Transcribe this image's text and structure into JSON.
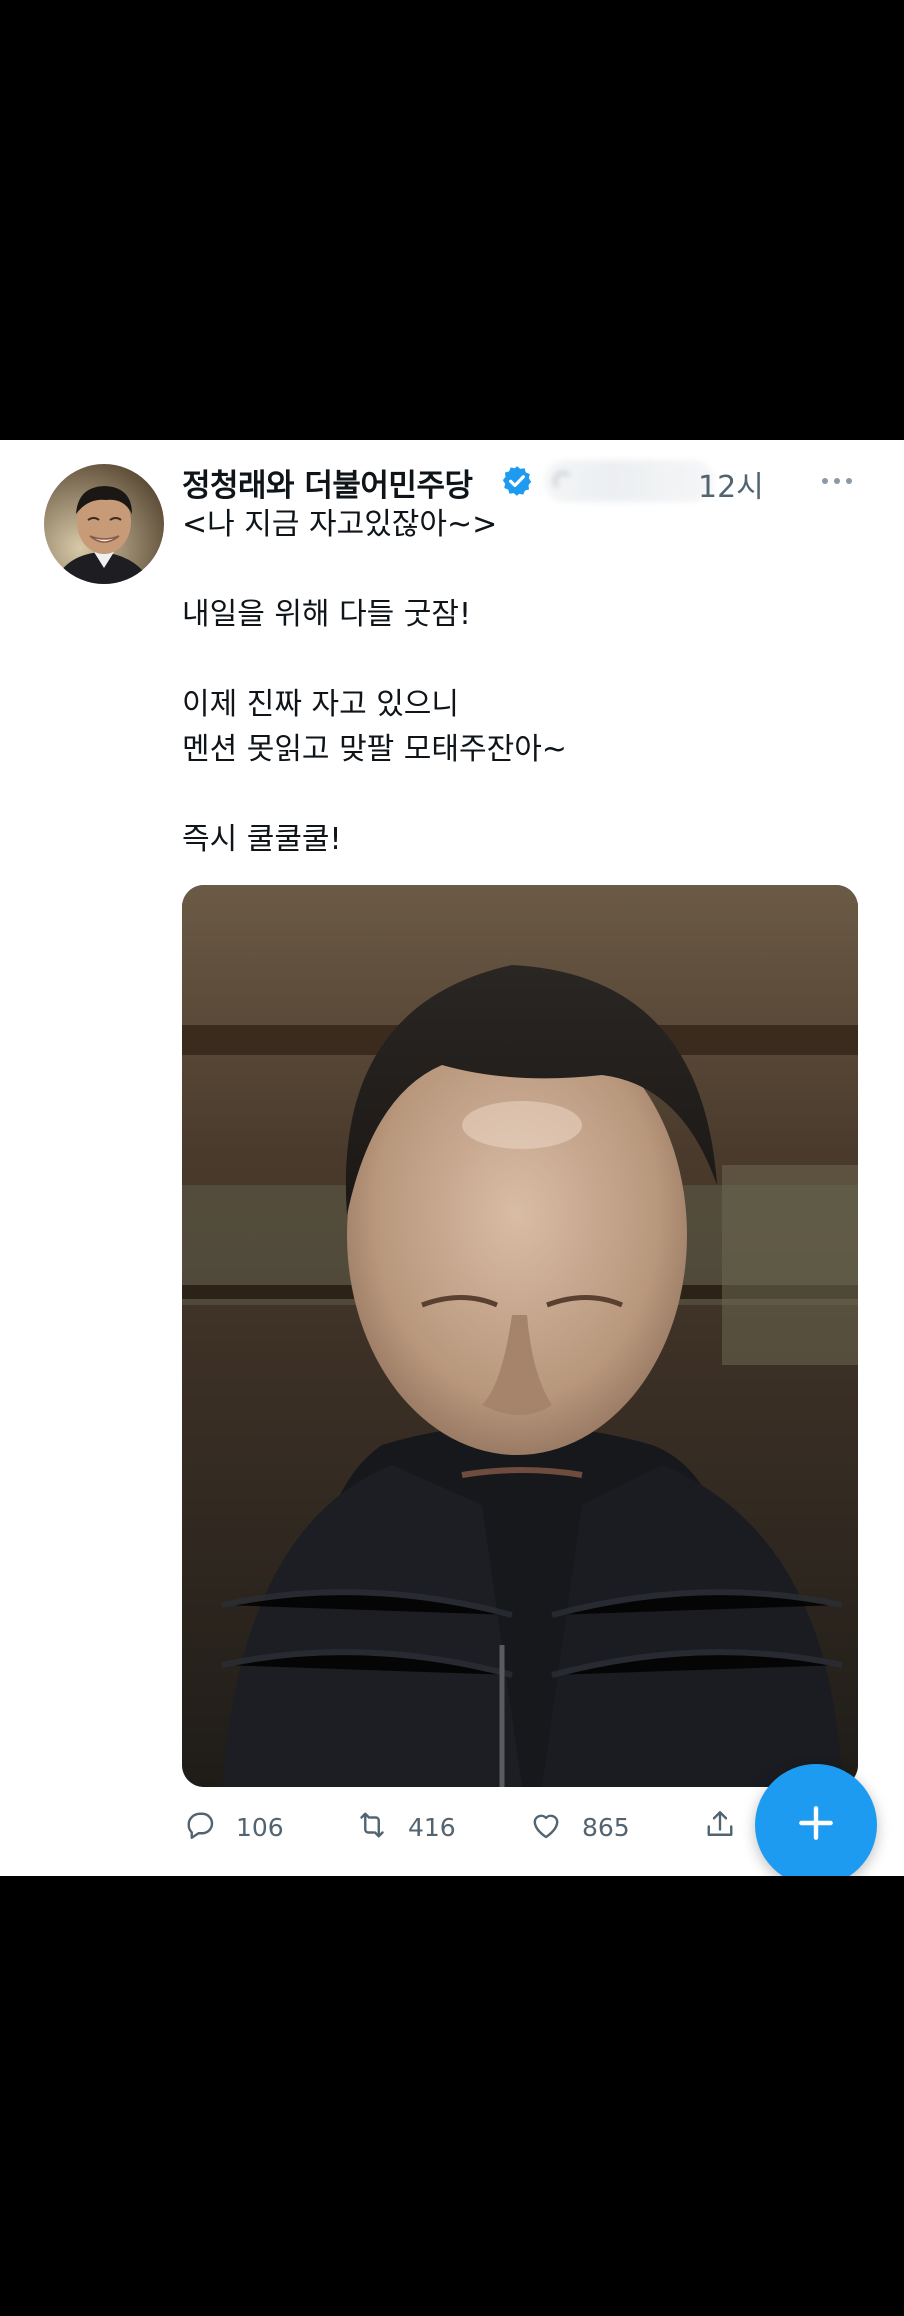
{
  "tweet": {
    "display_name": "정청래와 더불어민주당",
    "verified": true,
    "timestamp": "12시",
    "paragraphs": [
      "<나 지금 자고있잖아~>",
      "내일을 위해 다들 굿잠!",
      "이제 진짜 자고 있으니\n멘션 못읽고 맞팔 모태주잔아~",
      "즉시 쿨쿨쿨!"
    ],
    "actions": {
      "reply_count": "106",
      "retweet_count": "416",
      "like_count": "865"
    }
  },
  "icons": {
    "verified": "verified-badge-icon",
    "more": "more-dots-icon",
    "reply": "speech-bubble-icon",
    "retweet": "retweet-arrows-icon",
    "like": "heart-icon",
    "share": "share-upload-icon",
    "compose": "plus-icon"
  },
  "colors": {
    "accent": "#1d9bf0",
    "text_primary": "#0f1419",
    "text_secondary": "#536471",
    "background": "#ffffff",
    "letterbox": "#000000"
  }
}
